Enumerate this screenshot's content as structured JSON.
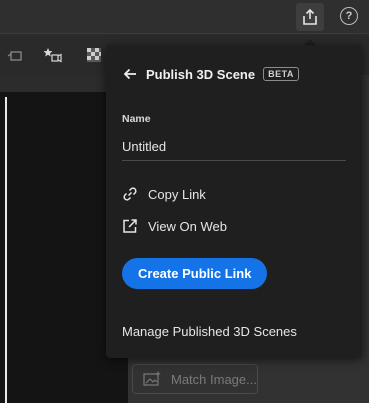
{
  "topbar": {
    "share_icon": "share-upload-icon",
    "help_symbol": "?"
  },
  "toolbar": {
    "icons": [
      "rotate-object-icon",
      "add-light-icon",
      "environment-icon"
    ]
  },
  "sidebar": {
    "match_image_label": "Match Image..."
  },
  "popover": {
    "title": "Publish 3D Scene",
    "badge": "BETA",
    "name_label": "Name",
    "name_value": "Untitled",
    "copy_link_label": "Copy Link",
    "view_on_web_label": "View On Web",
    "create_link_label": "Create Public Link",
    "manage_label": "Manage Published 3D Scenes"
  },
  "colors": {
    "accent": "#1473e6",
    "popover_bg": "#1f1f1f",
    "app_bg": "#2c2c2c"
  }
}
